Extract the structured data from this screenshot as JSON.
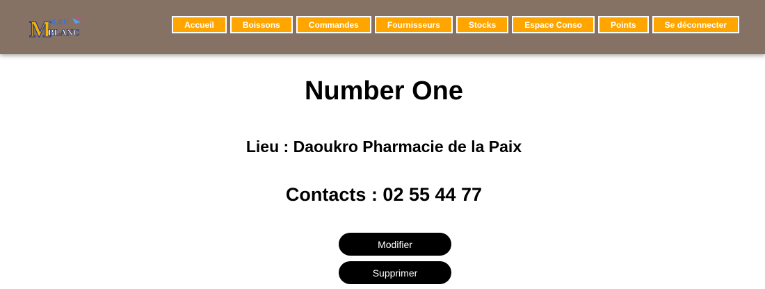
{
  "logo": {
    "mark": "M",
    "line1": "BLEU",
    "line2": "BLANC"
  },
  "nav": {
    "items": [
      {
        "label": "Accueil"
      },
      {
        "label": "Boissons"
      },
      {
        "label": "Commandes"
      },
      {
        "label": "Fournisseurs"
      },
      {
        "label": "Stocks"
      },
      {
        "label": "Espace Conso"
      },
      {
        "label": "Points"
      },
      {
        "label": "Se déconnecter"
      }
    ]
  },
  "main": {
    "title": "Number One",
    "location": "Lieu : Daoukro Pharmacie de la Paix",
    "contacts": "Contacts : 02 55 44 77",
    "modify_label": "Modifier",
    "delete_label": "Supprimer"
  },
  "colors": {
    "header_bg": "#857265",
    "nav_bg": "#ffa500",
    "button_bg": "#000000"
  }
}
